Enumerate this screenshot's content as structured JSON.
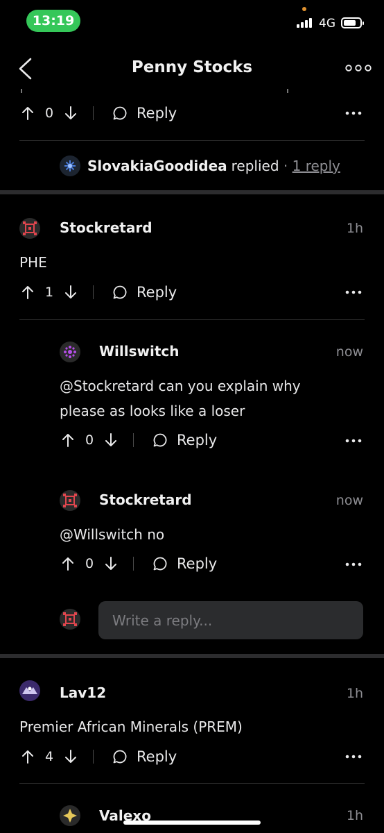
{
  "status_bar": {
    "time": "13:19",
    "network": "4G"
  },
  "header": {
    "title": "Penny Stocks"
  },
  "top_comment": {
    "votes": "0",
    "reply_label": "Reply",
    "reply_summary": {
      "user": "SlovakiaGoodidea",
      "text": "replied",
      "separator": " · ",
      "link": "1 reply"
    }
  },
  "comments": [
    {
      "user": "Stockretard",
      "time": "1h",
      "text": "PHE",
      "votes": "1",
      "reply_label": "Reply",
      "replies": [
        {
          "user": "Willswitch",
          "time": "now",
          "text_line1": "@Stockretard can you explain why",
          "text_line2": "please as looks like a loser",
          "votes": "0",
          "reply_label": "Reply"
        },
        {
          "user": "Stockretard",
          "time": "now",
          "text": "@Willswitch no",
          "votes": "0",
          "reply_label": "Reply"
        }
      ],
      "reply_input": {
        "placeholder": "Write a reply..."
      }
    },
    {
      "user": "Lav12",
      "time": "1h",
      "text": "Premier African Minerals (PREM)",
      "votes": "4",
      "reply_label": "Reply",
      "replies": [
        {
          "user": "Valexo",
          "time": "1h"
        }
      ]
    }
  ],
  "colors": {
    "background": "#000000",
    "status_green": "#35c759",
    "input_bg": "#2b2c2e",
    "muted": "#8e8e93"
  }
}
